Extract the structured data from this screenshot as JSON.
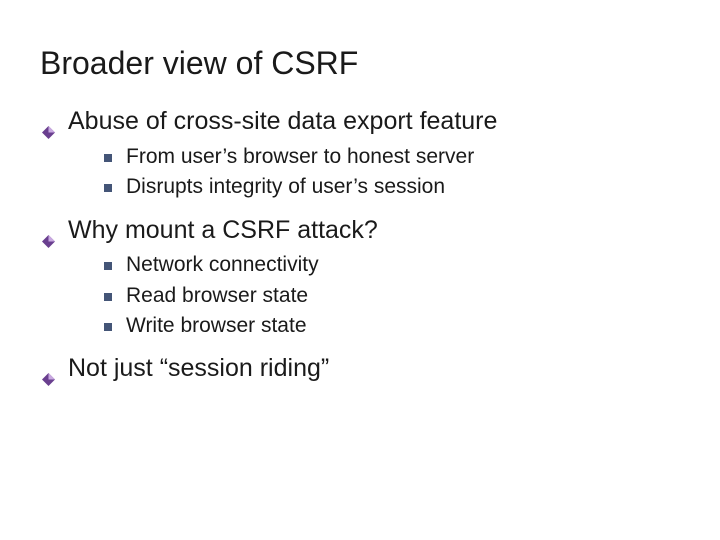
{
  "colors": {
    "diamond_fill": "#6a3f8f",
    "diamond_highlight": "#c8a8e0",
    "square_fill": "#445577"
  },
  "title": "Broader view of CSRF",
  "bullets": [
    {
      "text": "Abuse of cross-site data export feature",
      "sub": [
        "From user’s browser to honest server",
        "Disrupts integrity of user’s session"
      ]
    },
    {
      "text": "Why mount a CSRF attack?",
      "sub": [
        "Network connectivity",
        "Read browser state",
        "Write browser state"
      ]
    },
    {
      "text": "Not just “session riding”",
      "sub": []
    }
  ]
}
